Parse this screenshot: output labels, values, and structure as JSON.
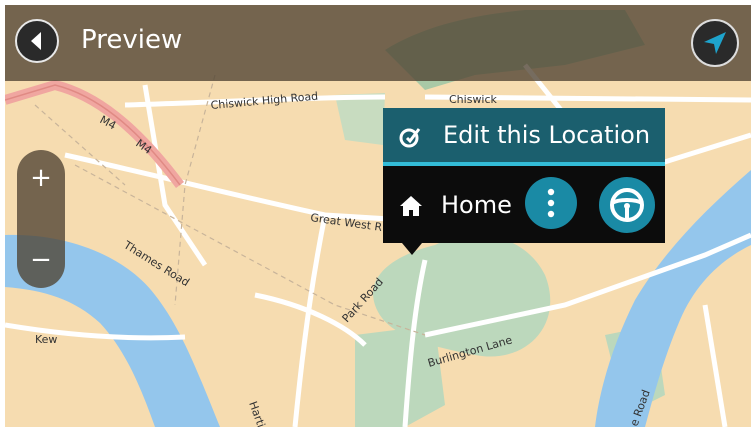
{
  "header": {
    "title": "Preview",
    "back_icon": "back-arrow-icon",
    "location_icon": "current-location-icon"
  },
  "zoom": {
    "in_label": "+",
    "out_label": "−"
  },
  "popup": {
    "edit_label": "Edit this Location",
    "edit_icon": "edit-location-icon",
    "home_label": "Home",
    "home_icon": "home-icon",
    "more_icon": "more-options-icon",
    "drive_icon": "steering-wheel-icon"
  },
  "map": {
    "labels": {
      "chiswick_high_road": "Chiswick High Road",
      "chiswick": "Chiswick",
      "m4_a": "M4",
      "m4_b": "M4",
      "great_west_road": "Great West R",
      "thames_road": "Thames Road",
      "park_road": "Park Road",
      "burlington_lane": "Burlington Lane",
      "kew": "Kew",
      "harting": "Hartin",
      "road_right": "e Road"
    }
  },
  "colors": {
    "map_land": "#f6dcb0",
    "river": "#94c6ec",
    "park": "#bcd8bc",
    "popup_top": "#1b5f6e",
    "popup_accent": "#33bcd8",
    "button_blue": "#1a8aa5",
    "motorway": "#f0a6a0"
  }
}
